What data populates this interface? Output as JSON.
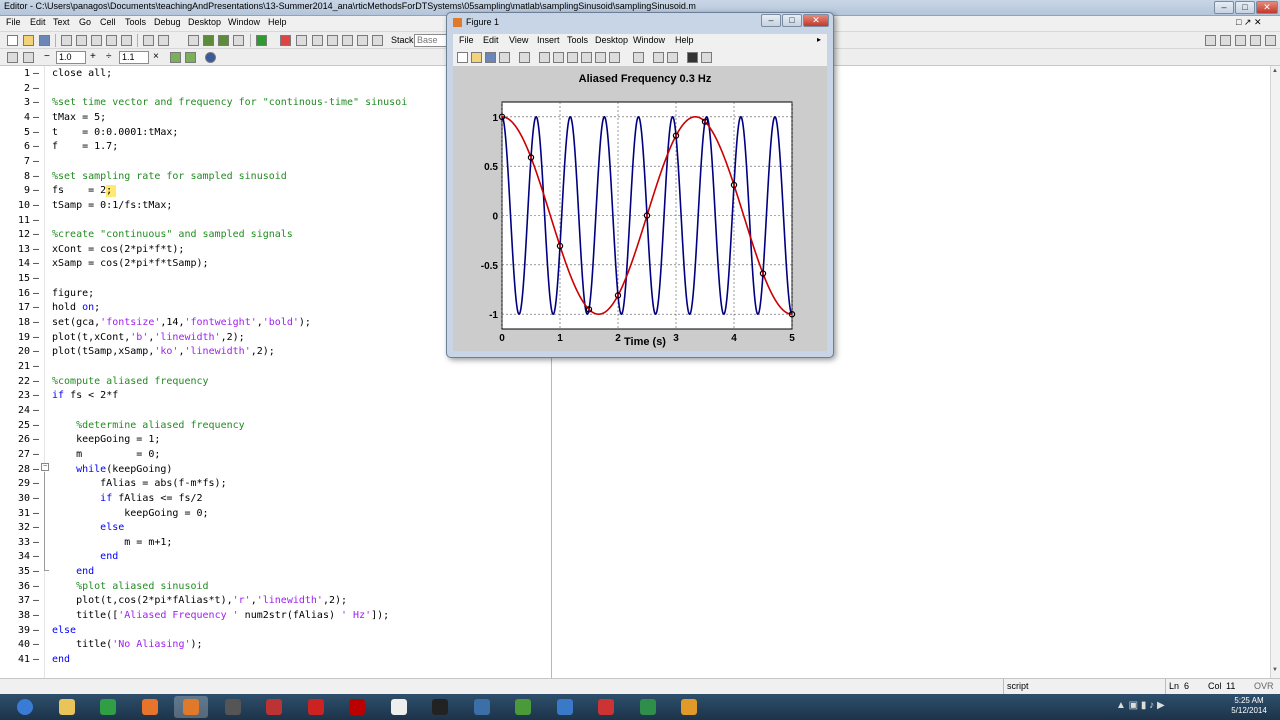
{
  "window": {
    "title": "Editor - C:\\Users\\panagos\\Documents\\teachingAndPresentations\\13-Summer2014_ana\\rticMethodsForDTSystems\\05sampling\\matlab\\samplingSinusoid\\samplingSinusoid.m",
    "controls": [
      "–",
      "□",
      "✕"
    ]
  },
  "menu": [
    "File",
    "Edit",
    "Text",
    "Go",
    "Cell",
    "Tools",
    "Debug",
    "Desktop",
    "Window",
    "Help"
  ],
  "toolbar": {
    "stack_label": "Stack:",
    "stack_value": "Base",
    "cell_minus": "−",
    "cell_value1": "1.0",
    "cell_plus": "+",
    "cell_div": "÷",
    "cell_value2": "1.1",
    "cell_times": "×"
  },
  "code": [
    {
      "n": "1",
      "t": "close all;"
    },
    {
      "n": "2",
      "t": ""
    },
    {
      "n": "3",
      "t": "%set time vector and frequency for \"continous-time\" sinusoi"
    },
    {
      "n": "4",
      "t": "tMax = 5;"
    },
    {
      "n": "5",
      "t": "t    = 0:0.0001:tMax;"
    },
    {
      "n": "6",
      "t": "f    = 1.7;"
    },
    {
      "n": "7",
      "t": ""
    },
    {
      "n": "8",
      "t": "%set sampling rate for sampled sinusoid"
    },
    {
      "n": "9",
      "t": "fs    = 2;"
    },
    {
      "n": "10",
      "t": "tSamp = 0:1/fs:tMax;"
    },
    {
      "n": "11",
      "t": ""
    },
    {
      "n": "12",
      "t": "%create \"continuous\" and sampled signals"
    },
    {
      "n": "13",
      "t": "xCont = cos(2*pi*f*t);"
    },
    {
      "n": "14",
      "t": "xSamp = cos(2*pi*f*tSamp);"
    },
    {
      "n": "15",
      "t": ""
    },
    {
      "n": "16",
      "t": "figure;"
    },
    {
      "n": "17",
      "t": "hold on;"
    },
    {
      "n": "18",
      "t": "set(gca,'fontsize',14,'fontweight','bold');"
    },
    {
      "n": "19",
      "t": "plot(t,xCont,'b','linewidth',2);"
    },
    {
      "n": "20",
      "t": "plot(tSamp,xSamp,'ko','linewidth',2);"
    },
    {
      "n": "21",
      "t": ""
    },
    {
      "n": "22",
      "t": "%compute aliased frequency"
    },
    {
      "n": "23",
      "t": "if fs < 2*f"
    },
    {
      "n": "24",
      "t": ""
    },
    {
      "n": "25",
      "t": "    %determine aliased frequency"
    },
    {
      "n": "26",
      "t": "    keepGoing = 1;"
    },
    {
      "n": "27",
      "t": "    m         = 0;"
    },
    {
      "n": "28",
      "t": "    while(keepGoing)"
    },
    {
      "n": "29",
      "t": "        fAlias = abs(f-m*fs);"
    },
    {
      "n": "30",
      "t": "        if fAlias <= fs/2"
    },
    {
      "n": "31",
      "t": "            keepGoing = 0;"
    },
    {
      "n": "32",
      "t": "        else"
    },
    {
      "n": "33",
      "t": "            m = m+1;"
    },
    {
      "n": "34",
      "t": "        end"
    },
    {
      "n": "35",
      "t": "    end"
    },
    {
      "n": "36",
      "t": "    %plot aliased sinusoid"
    },
    {
      "n": "37",
      "t": "    plot(t,cos(2*pi*fAlias*t),'r','linewidth',2);"
    },
    {
      "n": "38",
      "t": "    title(['Aliased Frequency ' num2str(fAlias) ' Hz']);"
    },
    {
      "n": "39",
      "t": "else"
    },
    {
      "n": "40",
      "t": "    title('No Aliasing');"
    },
    {
      "n": "41",
      "t": "end"
    }
  ],
  "statusbar": {
    "mode": "script",
    "ln_label": "Ln",
    "ln": "6",
    "col_label": "Col",
    "col": "11",
    "ovr": "OVR"
  },
  "taskbar": {
    "time": "5:25 AM",
    "date": "5/12/2014",
    "apps": [
      "start-icon",
      "explorer-icon",
      "chrome-icon",
      "firefox-icon",
      "matlab-icon",
      "app-icon",
      "adobe-icon",
      "quicken-icon",
      "mendeley-icon",
      "vlc-icon",
      "terminal-icon",
      "python-icon",
      "evernote-icon",
      "calendar-icon",
      "pdf-icon",
      "drive-icon",
      "headphones-icon"
    ]
  },
  "figure": {
    "window_title": "Figure 1",
    "menu": [
      "File",
      "Edit",
      "View",
      "Insert",
      "Tools",
      "Desktop",
      "Window",
      "Help"
    ]
  },
  "chart_data": {
    "type": "line",
    "title": "Aliased Frequency 0.3 Hz",
    "xlabel": "Time (s)",
    "ylabel": "",
    "xlim": [
      0,
      5
    ],
    "ylim": [
      -1.15,
      1.15
    ],
    "xticks": [
      "0",
      "1",
      "2",
      "3",
      "4",
      "5"
    ],
    "yticks": [
      "1",
      "0.5",
      "0",
      "-0.5",
      "-1"
    ],
    "grid": true,
    "series": [
      {
        "kind": "continuous",
        "frequency_hz": 1.7,
        "color": "#000080"
      },
      {
        "kind": "continuous",
        "frequency_hz": 0.3,
        "color": "#cc0000"
      },
      {
        "kind": "samples",
        "marker": "o",
        "color": "#000000",
        "x": [
          0,
          0.5,
          1,
          1.5,
          2,
          2.5,
          3,
          3.5,
          4,
          4.5,
          5
        ],
        "y": [
          1,
          0.588,
          -0.309,
          -0.951,
          -0.809,
          0,
          0.809,
          0.951,
          0.309,
          -0.588,
          -1
        ]
      }
    ]
  }
}
